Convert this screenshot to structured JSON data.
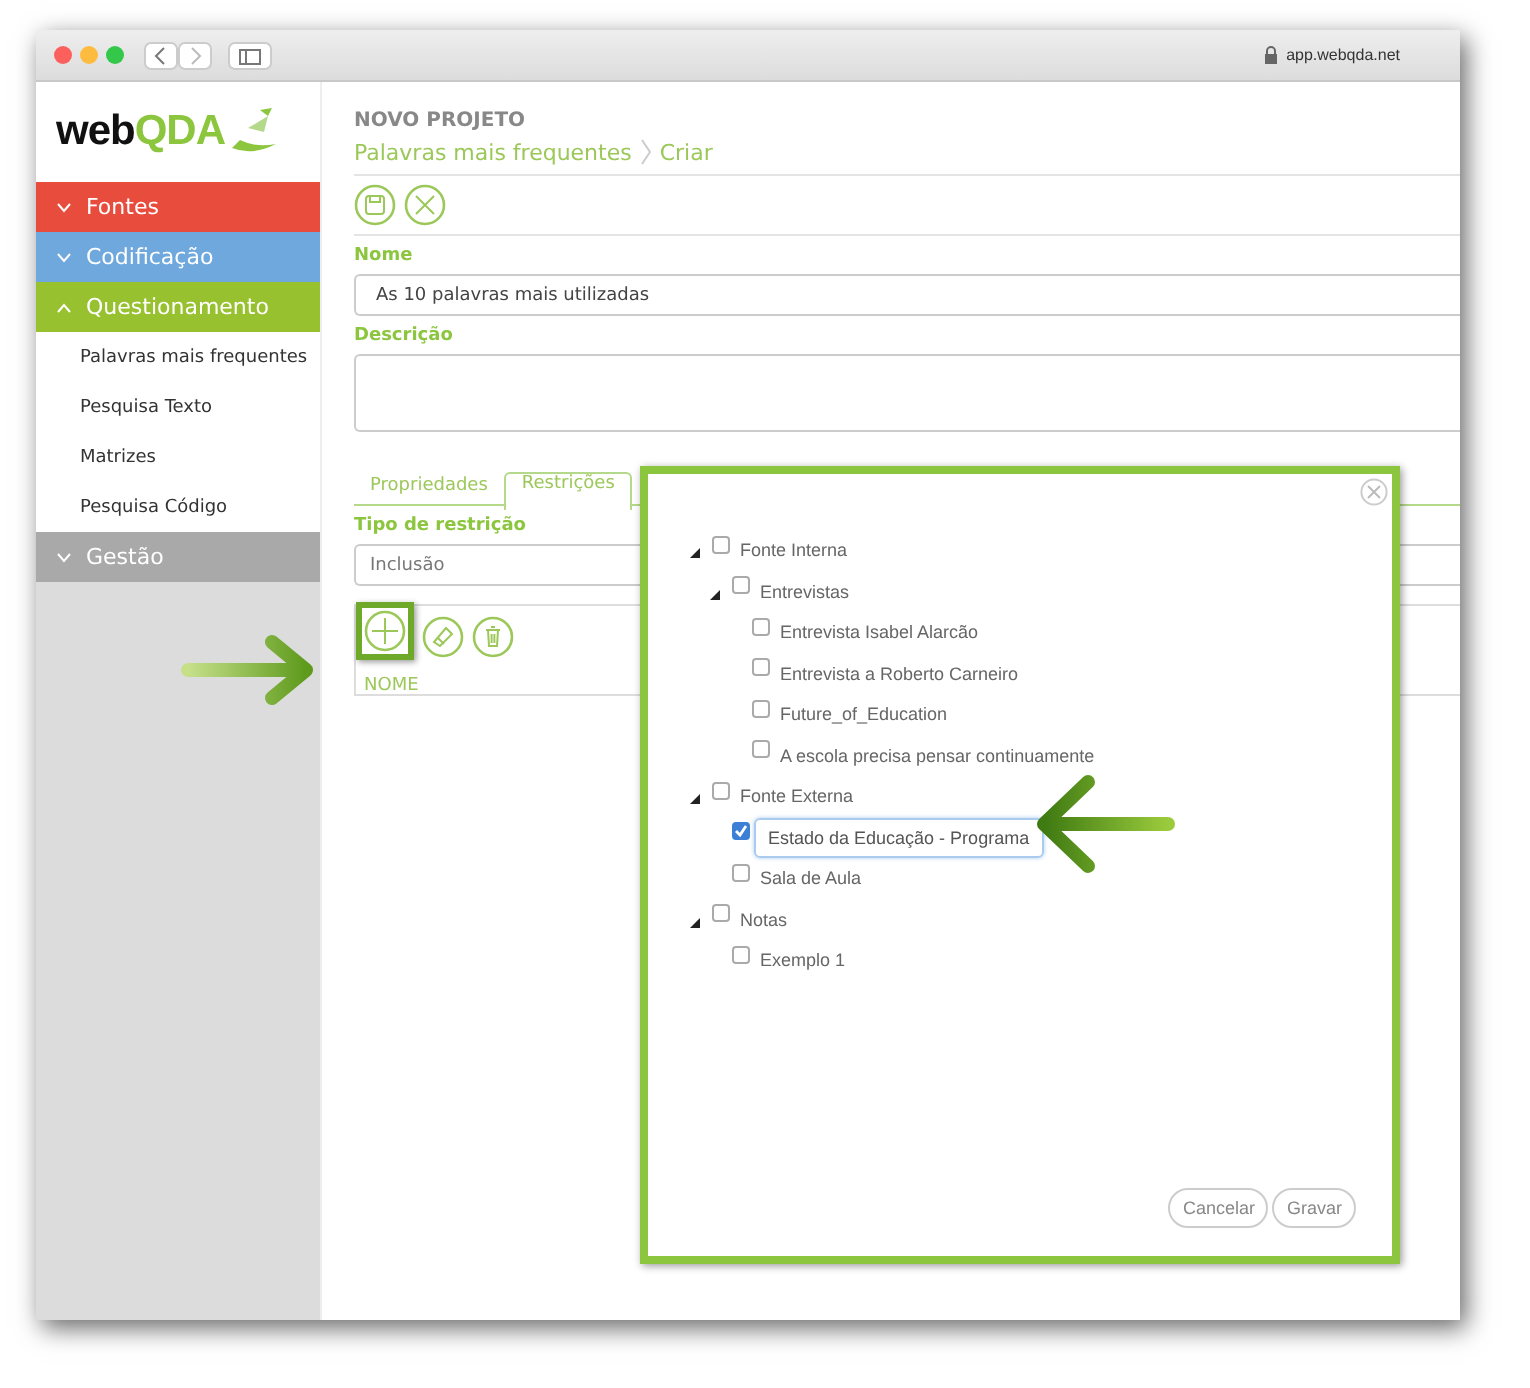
{
  "browser": {
    "url": "app.webqda.net"
  },
  "sidebar": {
    "logo": {
      "dark": "web",
      "accent": "QDA"
    },
    "sections": [
      {
        "label": "Fontes",
        "color": "#e84c3d",
        "expanded": false
      },
      {
        "label": "Codificação",
        "color": "#6fa8dc",
        "expanded": false
      },
      {
        "label": "Questionamento",
        "color": "#97c12f",
        "expanded": true,
        "items": [
          "Palavras mais frequentes",
          "Pesquisa Texto",
          "Matrizes",
          "Pesquisa Código"
        ]
      },
      {
        "label": "Gestão",
        "color": "#a9a9a9",
        "expanded": false
      }
    ]
  },
  "header": {
    "project": "NOVO PROJETO",
    "breadcrumb": [
      "Palavras mais frequentes",
      "Criar"
    ]
  },
  "form": {
    "name_label": "Nome",
    "name_value": "As 10 palavras mais utilizadas",
    "description_label": "Descrição"
  },
  "tabs": [
    {
      "label": "Propriedades",
      "selected": false
    },
    {
      "label": "Restrições",
      "selected": true
    }
  ],
  "restriction": {
    "type_label": "Tipo de restrição",
    "type_value": "Inclusão",
    "column": "NOME"
  },
  "dialog": {
    "tree": [
      {
        "label": "Fonte Interna",
        "checked": false,
        "selected": false,
        "expanded": true,
        "children": [
          {
            "label": "Entrevistas",
            "checked": false,
            "selected": false,
            "expanded": true,
            "children": [
              {
                "label": "Entrevista Isabel Alarcão",
                "checked": false,
                "selected": false
              },
              {
                "label": "Entrevista a Roberto Carneiro",
                "checked": false,
                "selected": false
              },
              {
                "label": "Future_of_Education",
                "checked": false,
                "selected": false
              },
              {
                "label": "A escola precisa pensar continuamente",
                "checked": false,
                "selected": false
              }
            ]
          }
        ]
      },
      {
        "label": "Fonte Externa",
        "checked": false,
        "selected": false,
        "expanded": true,
        "children": [
          {
            "label": "Estado da Educação - Programa",
            "checked": true,
            "selected": true
          },
          {
            "label": "Sala de Aula",
            "checked": false,
            "selected": false
          }
        ]
      },
      {
        "label": "Notas",
        "checked": false,
        "selected": false,
        "expanded": true,
        "children": [
          {
            "label": "Exemplo 1",
            "checked": false,
            "selected": false
          }
        ]
      }
    ],
    "buttons": [
      "Cancelar",
      "Gravar"
    ]
  }
}
